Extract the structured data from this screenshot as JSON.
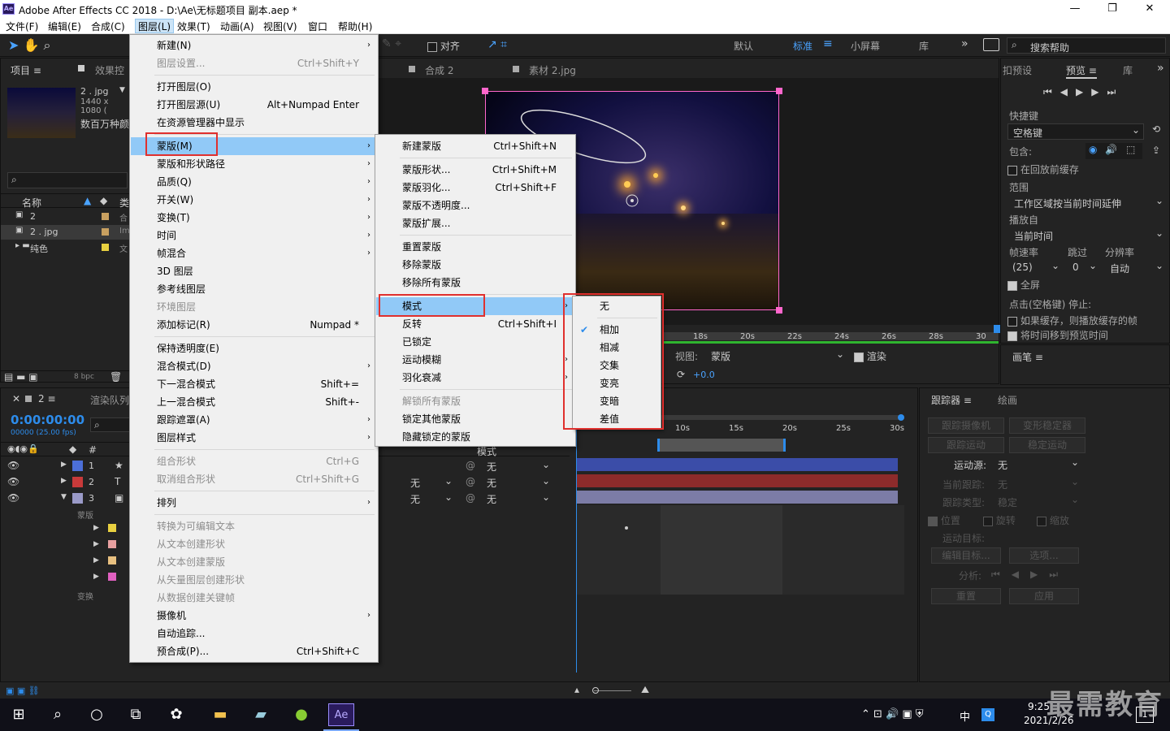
{
  "window": {
    "title": "Adobe After Effects CC 2018 - D:\\Ae\\无标题项目 副本.aep *",
    "app_icon": "Ae",
    "min": "—",
    "max": "❐",
    "close": "✕"
  },
  "menubar": [
    "文件(F)",
    "编辑(E)",
    "合成(C)",
    "图层(L)",
    "效果(T)",
    "动画(A)",
    "视图(V)",
    "窗口",
    "帮助(H)"
  ],
  "toolbar": {
    "snap": "对齐",
    "workspaces": [
      "默认",
      "标准",
      "小屏幕",
      "库"
    ],
    "search": "搜索帮助"
  },
  "project": {
    "tab1": "项目",
    "tab2": "效果控",
    "item_name": "2 . jpg",
    "item_dims": "1440 x 1080 (",
    "item_colors": "数百万种颜",
    "col_name": "名称",
    "col_type": "类",
    "rows": [
      {
        "name": "2",
        "type": "合"
      },
      {
        "name": "2 . jpg",
        "type": "Im"
      },
      {
        "name": "纯色",
        "type": "文"
      }
    ],
    "bpc": "8 bpc"
  },
  "comp_viewer": {
    "tab1": "合成 2",
    "tab2": "素材 2.jpg",
    "ruler": [
      "18s",
      "20s",
      "22s",
      "24s",
      "26s",
      "28s",
      "30"
    ],
    "view_label": "视图:",
    "view_value": "蒙版",
    "render_label": "渲染",
    "offset": "+0.0"
  },
  "timeline": {
    "tab": "2",
    "render_queue": "渲染队列",
    "timecode": "0:00:00:00",
    "fps": "00000 (25.00 fps)",
    "col_num": "#",
    "col_mode": "模式",
    "ruler": [
      "10s",
      "15s",
      "20s",
      "25s",
      "30s"
    ],
    "layers": [
      {
        "num": "1",
        "icon": "★"
      },
      {
        "num": "2",
        "icon": "T"
      },
      {
        "num": "3",
        "icon": "▣"
      }
    ],
    "mask_group": "蒙版",
    "transform_group": "变换",
    "none": "无"
  },
  "layer_menu": [
    {
      "label": "新建(N)",
      "shortcut": "",
      "sub": true,
      "dis": false
    },
    {
      "label": "图层设置...",
      "shortcut": "Ctrl+Shift+Y",
      "sub": false,
      "dis": true
    },
    {
      "sep": true
    },
    {
      "label": "打开图层(O)",
      "shortcut": "",
      "sub": false,
      "dis": false
    },
    {
      "label": "打开图层源(U)",
      "shortcut": "Alt+Numpad Enter",
      "sub": false,
      "dis": false
    },
    {
      "label": "在资源管理器中显示",
      "shortcut": "",
      "sub": false,
      "dis": false
    },
    {
      "sep": true
    },
    {
      "label": "蒙版(M)",
      "shortcut": "",
      "sub": true,
      "dis": false,
      "hl": true
    },
    {
      "label": "蒙版和形状路径",
      "shortcut": "",
      "sub": true,
      "dis": false
    },
    {
      "label": "品质(Q)",
      "shortcut": "",
      "sub": true,
      "dis": false
    },
    {
      "label": "开关(W)",
      "shortcut": "",
      "sub": true,
      "dis": false
    },
    {
      "label": "变换(T)",
      "shortcut": "",
      "sub": true,
      "dis": false
    },
    {
      "label": "时间",
      "shortcut": "",
      "sub": true,
      "dis": false
    },
    {
      "label": "帧混合",
      "shortcut": "",
      "sub": true,
      "dis": false
    },
    {
      "label": "3D 图层",
      "shortcut": "",
      "sub": false,
      "dis": false
    },
    {
      "label": "参考线图层",
      "shortcut": "",
      "sub": false,
      "dis": false
    },
    {
      "label": "环境图层",
      "shortcut": "",
      "sub": false,
      "dis": true
    },
    {
      "label": "添加标记(R)",
      "shortcut": "Numpad *",
      "sub": false,
      "dis": false
    },
    {
      "sep": true
    },
    {
      "label": "保持透明度(E)",
      "shortcut": "",
      "sub": false,
      "dis": false
    },
    {
      "label": "混合模式(D)",
      "shortcut": "",
      "sub": true,
      "dis": false
    },
    {
      "label": "下一混合模式",
      "shortcut": "Shift+=",
      "sub": false,
      "dis": false
    },
    {
      "label": "上一混合模式",
      "shortcut": "Shift+-",
      "sub": false,
      "dis": false
    },
    {
      "label": "跟踪遮罩(A)",
      "shortcut": "",
      "sub": true,
      "dis": false
    },
    {
      "label": "图层样式",
      "shortcut": "",
      "sub": true,
      "dis": false
    },
    {
      "sep": true
    },
    {
      "label": "组合形状",
      "shortcut": "Ctrl+G",
      "sub": false,
      "dis": true
    },
    {
      "label": "取消组合形状",
      "shortcut": "Ctrl+Shift+G",
      "sub": false,
      "dis": true
    },
    {
      "sep": true
    },
    {
      "label": "排列",
      "shortcut": "",
      "sub": true,
      "dis": false
    },
    {
      "sep": true
    },
    {
      "label": "转换为可编辑文本",
      "shortcut": "",
      "sub": false,
      "dis": true
    },
    {
      "label": "从文本创建形状",
      "shortcut": "",
      "sub": false,
      "dis": true
    },
    {
      "label": "从文本创建蒙版",
      "shortcut": "",
      "sub": false,
      "dis": true
    },
    {
      "label": "从矢量图层创建形状",
      "shortcut": "",
      "sub": false,
      "dis": true
    },
    {
      "label": "从数据创建关键帧",
      "shortcut": "",
      "sub": false,
      "dis": true
    },
    {
      "label": "摄像机",
      "shortcut": "",
      "sub": true,
      "dis": false
    },
    {
      "label": "自动追踪...",
      "shortcut": "",
      "sub": false,
      "dis": false
    },
    {
      "label": "预合成(P)...",
      "shortcut": "Ctrl+Shift+C",
      "sub": false,
      "dis": false
    }
  ],
  "mask_menu": [
    {
      "label": "新建蒙版",
      "shortcut": "Ctrl+Shift+N",
      "sub": false,
      "dis": false
    },
    {
      "sep": true
    },
    {
      "label": "蒙版形状...",
      "shortcut": "Ctrl+Shift+M",
      "sub": false,
      "dis": false
    },
    {
      "label": "蒙版羽化...",
      "shortcut": "Ctrl+Shift+F",
      "sub": false,
      "dis": false
    },
    {
      "label": "蒙版不透明度...",
      "shortcut": "",
      "sub": false,
      "dis": false
    },
    {
      "label": "蒙版扩展...",
      "shortcut": "",
      "sub": false,
      "dis": false
    },
    {
      "sep": true
    },
    {
      "label": "重置蒙版",
      "shortcut": "",
      "sub": false,
      "dis": false
    },
    {
      "label": "移除蒙版",
      "shortcut": "",
      "sub": false,
      "dis": false
    },
    {
      "label": "移除所有蒙版",
      "shortcut": "",
      "sub": false,
      "dis": false
    },
    {
      "sep": true
    },
    {
      "label": "模式",
      "shortcut": "",
      "sub": true,
      "dis": false,
      "hl": true
    },
    {
      "label": "反转",
      "shortcut": "Ctrl+Shift+I",
      "sub": false,
      "dis": false
    },
    {
      "label": "已锁定",
      "shortcut": "",
      "sub": false,
      "dis": false
    },
    {
      "label": "运动模糊",
      "shortcut": "",
      "sub": true,
      "dis": false
    },
    {
      "label": "羽化衰减",
      "shortcut": "",
      "sub": true,
      "dis": false
    },
    {
      "sep": true
    },
    {
      "label": "解锁所有蒙版",
      "shortcut": "",
      "sub": false,
      "dis": true
    },
    {
      "label": "锁定其他蒙版",
      "shortcut": "",
      "sub": false,
      "dis": false
    },
    {
      "label": "隐藏锁定的蒙版",
      "shortcut": "",
      "sub": false,
      "dis": false
    }
  ],
  "mode_menu": [
    {
      "label": "无",
      "checked": false
    },
    {
      "sep": true
    },
    {
      "label": "相加",
      "checked": true
    },
    {
      "label": "相减",
      "checked": false
    },
    {
      "label": "交集",
      "checked": false
    },
    {
      "label": "变亮",
      "checked": false
    },
    {
      "label": "变暗",
      "checked": false
    },
    {
      "label": "差值",
      "checked": false
    }
  ],
  "preview": {
    "tab_prev": "扣预设",
    "tab": "预览",
    "tab_lib": "库",
    "shortcut_label": "快捷键",
    "shortcut_value": "空格键",
    "include": "包含:",
    "cache_before": "在回放前缓存",
    "range": "范围",
    "range_value": "工作区域按当前时间延伸",
    "play_from": "播放自",
    "play_from_value": "当前时间",
    "frame_rate": "帧速率",
    "skip": "跳过",
    "resolution": "分辨率",
    "fps_value": "(25)",
    "skip_value": "0",
    "res_value": "自动",
    "fullscreen": "全屏",
    "stop_label": "点击(空格键) 停止:",
    "if_cached": "如果缓存，则播放缓存的帧",
    "move_time": "将时间移到预览时间",
    "brush": "画笔"
  },
  "tracker": {
    "tab": "跟踪器",
    "tab2": "绘画",
    "track_camera": "跟踪摄像机",
    "warp_stab": "变形稳定器",
    "track_motion": "跟踪运动",
    "stabilize": "稳定运动",
    "source_label": "运动源:",
    "source_value": "无",
    "current": "当前跟踪:",
    "current_value": "无",
    "type": "跟踪类型:",
    "type_value": "稳定",
    "position": "位置",
    "rotation": "旋转",
    "scale": "缩放",
    "target": "运动目标:",
    "edit_target": "编辑目标...",
    "options": "选项...",
    "analyze": "分析:",
    "reset": "重置",
    "apply": "应用"
  },
  "taskbar": {
    "time": "9:25",
    "date": "2021/2/26",
    "ime": "中",
    "badge": "1"
  },
  "watermark": "最需教育",
  "colors": {
    "bg": "#232323",
    "menu_hl": "#91c9f7",
    "red": "#e0302e",
    "blue_accent": "#2d8ceb"
  }
}
